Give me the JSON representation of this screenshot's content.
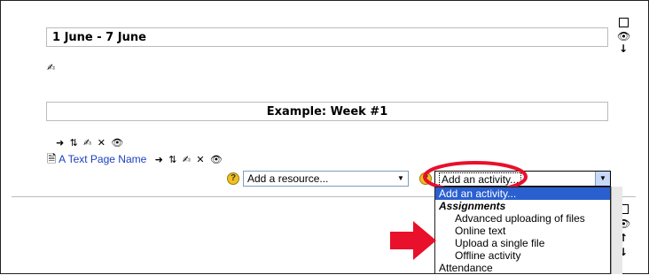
{
  "section1": {
    "week_title": "1 June - 7 June",
    "label_title": "Example: Week #1",
    "resource_link": "A Text Page Name",
    "add_resource_placeholder": "Add a resource...",
    "add_activity_value": "Add an activity..."
  },
  "dropdown": {
    "selected": "Add an activity...",
    "group": "Assignments",
    "items": [
      "Advanced uploading of files",
      "Online text",
      "Upload a single file",
      "Offline activity"
    ],
    "partial_item": "Attendance"
  },
  "icons": {
    "edit": "edit-pencil-icon",
    "move": "move-icon",
    "indent": "indent-arrow-icon",
    "delete": "delete-x-icon",
    "hide": "eye-icon",
    "help": "help-icon",
    "show_only": "square-icon",
    "move_down": "down-arrow-icon",
    "move_up": "up-arrow-icon",
    "page": "text-page-icon"
  },
  "colors": {
    "link": "#1a3fbf",
    "selection": "#2a5fd0",
    "highlight": "#e8102a"
  }
}
